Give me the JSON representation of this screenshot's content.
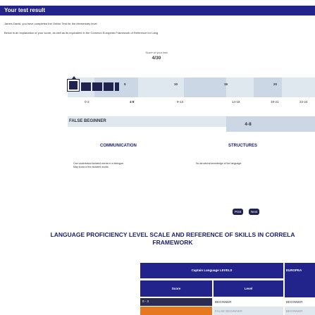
{
  "header": {
    "title": "Your test result"
  },
  "intro": {
    "line1": "James David, you have completed the Online Test for the elementary level",
    "line2": "Below is an explanation of your score, as well as its equivalent in the Common European Framework of Reference for Lang"
  },
  "score": {
    "label": "Score of your test",
    "value": "4/30",
    "fraction": 0.1333
  },
  "scale": {
    "ticks": [
      "5",
      "10",
      "15",
      "20"
    ],
    "ranges": [
      "0-3",
      "4-8",
      "9-13",
      "14-18",
      "19-21",
      "22-24"
    ],
    "active_range": "4-8"
  },
  "level": {
    "name": "FALSE BEGINNER",
    "range": "4-8"
  },
  "skills": {
    "communication_title": "COMMUNICATION",
    "communication_text1": "Can understand isolated words in a dialogue.",
    "communication_text2": "May know a few isolated words.",
    "structures_title": "STRUCTURES",
    "structures_text": "No structural knowledge of the language."
  },
  "actions": {
    "print": "Print",
    "next": "Next"
  },
  "language_scale": {
    "title_line1": "LANGUAGE PROFICIENCY LEVEL SCALE AND REFERENCE OF SKILLS IN CORRELA",
    "title_line2": "FRAMEWORK",
    "header_levels": "Captain Language LEVELS",
    "header_european": "EUROPEA",
    "col_score": "Score",
    "col_level": "Level",
    "rows": [
      {
        "score": "0 - 3",
        "level": "BEGINNER",
        "european": "BEGINNER"
      },
      {
        "score": "",
        "level": "FALSE BEGINNER",
        "european": "BEGINNER"
      }
    ]
  },
  "colors": {
    "primary": "#22238b",
    "dark": "#202250",
    "light": "#dfe7ef",
    "accent": "#e57920"
  }
}
